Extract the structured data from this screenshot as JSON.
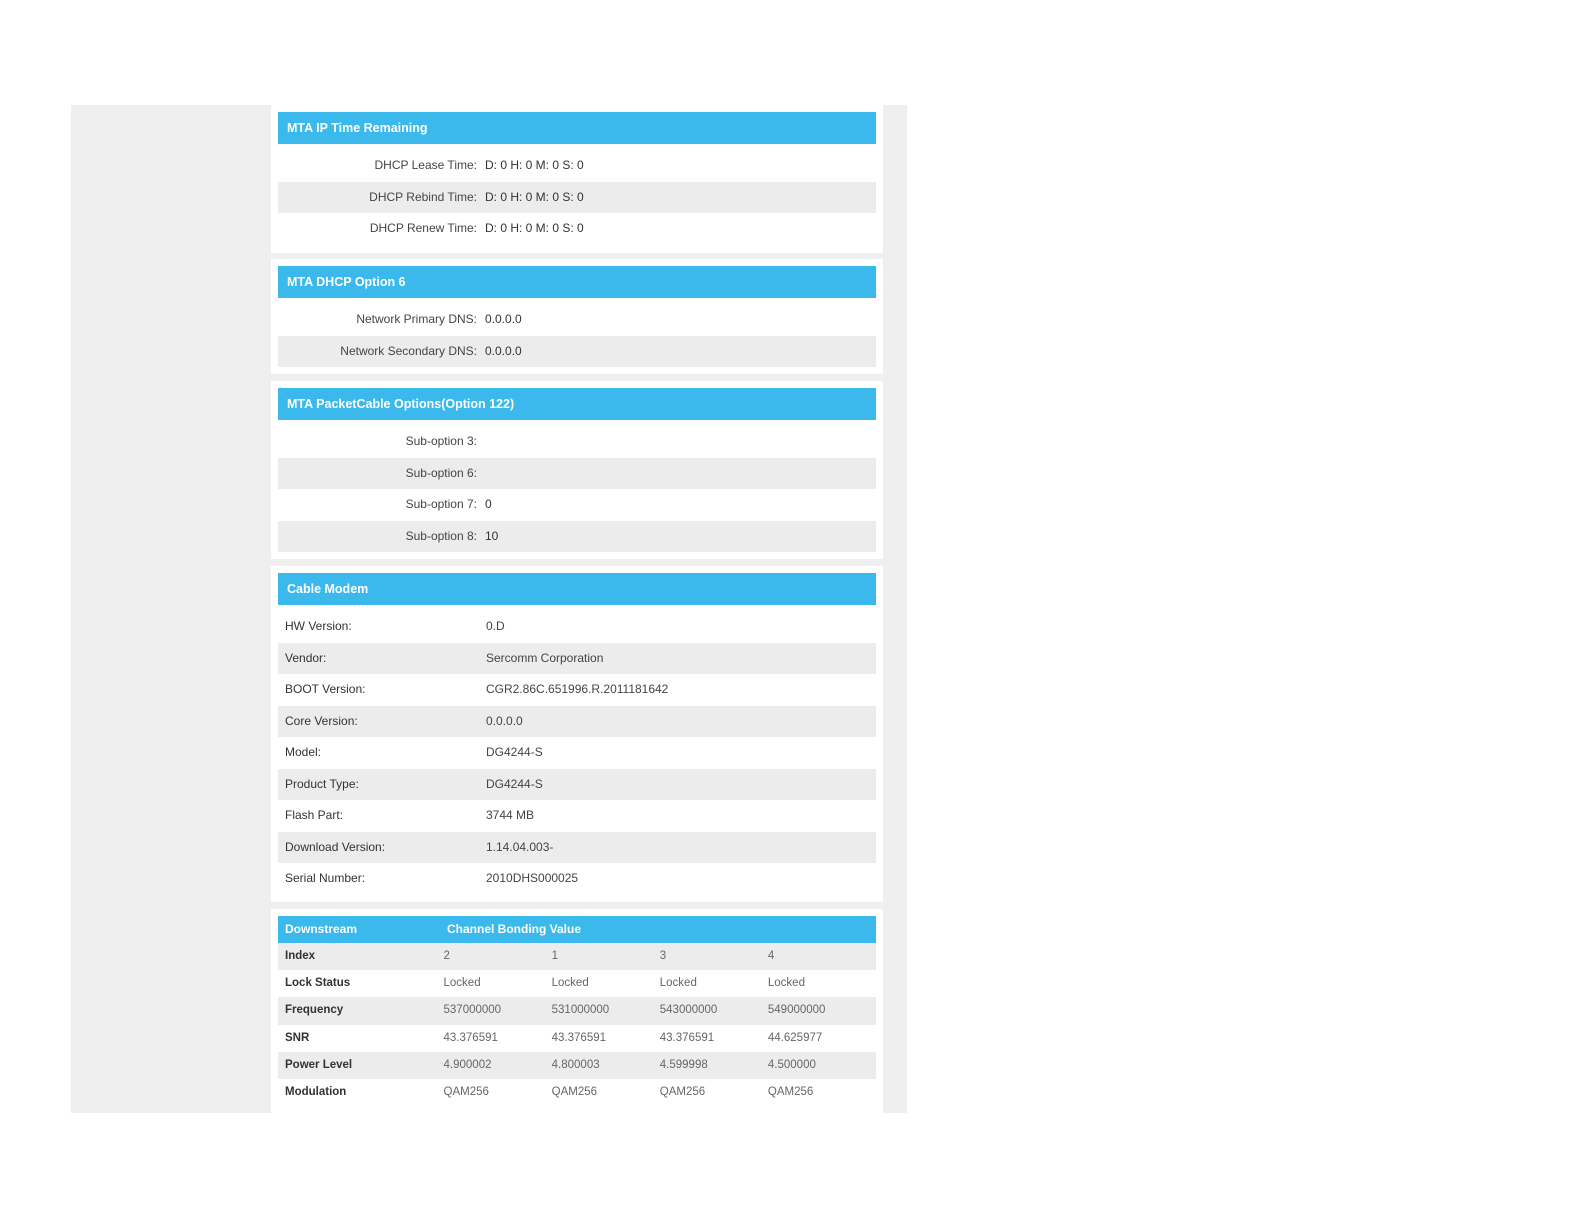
{
  "mta_ip_time": {
    "title": "MTA IP Time Remaining",
    "rows": [
      {
        "label": "DHCP Lease Time:",
        "value": "D: 0 H: 0 M: 0 S: 0"
      },
      {
        "label": "DHCP Rebind Time:",
        "value": "D: 0 H: 0 M: 0 S: 0"
      },
      {
        "label": "DHCP Renew Time:",
        "value": "D: 0 H: 0 M: 0 S: 0"
      }
    ]
  },
  "mta_dhcp_opt6": {
    "title": "MTA DHCP Option 6",
    "rows": [
      {
        "label": "Network Primary DNS:",
        "value": "0.0.0.0"
      },
      {
        "label": "Network Secondary DNS:",
        "value": "0.0.0.0"
      }
    ]
  },
  "mta_packetcable": {
    "title": "MTA PacketCable Options(Option 122)",
    "rows": [
      {
        "label": "Sub-option 3:",
        "value": ""
      },
      {
        "label": "Sub-option 6:",
        "value": ""
      },
      {
        "label": "Sub-option 7:",
        "value": "0"
      },
      {
        "label": "Sub-option 8:",
        "value": "10"
      }
    ]
  },
  "cable_modem": {
    "title": "Cable Modem",
    "rows": [
      {
        "label": "HW Version:",
        "value": "0.D"
      },
      {
        "label": "Vendor:",
        "value": "Sercomm Corporation"
      },
      {
        "label": "BOOT Version:",
        "value": "CGR2.86C.651996.R.2011181642"
      },
      {
        "label": "Core Version:",
        "value": "0.0.0.0"
      },
      {
        "label": "Model:",
        "value": "DG4244-S"
      },
      {
        "label": "Product Type:",
        "value": "DG4244-S"
      },
      {
        "label": "Flash Part:",
        "value": "3744 MB"
      },
      {
        "label": "Download Version:",
        "value": "1.14.04.003-"
      },
      {
        "label": "Serial Number:",
        "value": "2010DHS000025"
      }
    ]
  },
  "downstream": {
    "header": "Downstream",
    "header_value": "Channel Bonding Value",
    "rows": [
      {
        "label": "Index",
        "values": [
          "2",
          "1",
          "3",
          "4"
        ]
      },
      {
        "label": "Lock Status",
        "values": [
          "Locked",
          "Locked",
          "Locked",
          "Locked"
        ]
      },
      {
        "label": "Frequency",
        "values": [
          "537000000",
          "531000000",
          "543000000",
          "549000000"
        ]
      },
      {
        "label": "SNR",
        "values": [
          "43.376591",
          "43.376591",
          "43.376591",
          "44.625977"
        ]
      },
      {
        "label": "Power Level",
        "values": [
          "4.900002",
          "4.800003",
          "4.599998",
          "4.500000"
        ]
      },
      {
        "label": "Modulation",
        "values": [
          "QAM256",
          "QAM256",
          "QAM256",
          "QAM256"
        ]
      }
    ]
  }
}
